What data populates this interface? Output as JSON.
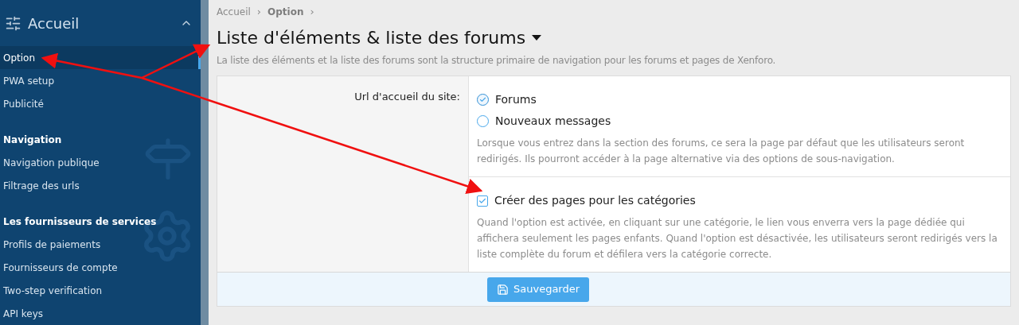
{
  "sidebar": {
    "header": {
      "title": "Accueil",
      "expanded": true
    },
    "sections": [
      {
        "items": [
          {
            "label": "Option",
            "selected": true
          },
          {
            "label": "PWA setup",
            "selected": false
          },
          {
            "label": "Publicité",
            "selected": false
          }
        ]
      },
      {
        "heading": "Navigation",
        "items": [
          {
            "label": "Navigation publique",
            "selected": false
          },
          {
            "label": "Filtrage des urls",
            "selected": false
          }
        ]
      },
      {
        "heading": "Les fournisseurs de services",
        "items": [
          {
            "label": "Profils de paiements",
            "selected": false
          },
          {
            "label": "Fournisseurs de compte",
            "selected": false
          },
          {
            "label": "Two-step verification",
            "selected": false
          },
          {
            "label": "API keys",
            "selected": false
          }
        ]
      }
    ]
  },
  "breadcrumb": [
    {
      "label": "Accueil",
      "current": false,
      "separator": "›"
    },
    {
      "label": "Option",
      "current": true,
      "separator": "›"
    }
  ],
  "page": {
    "title": "Liste d'éléments & liste des forums",
    "description": "La liste des éléments et la liste des forums sont la structure primaire de navigation pour les forums et pages de Xenforo."
  },
  "form": {
    "label": "Url d'accueil du site:",
    "groups": [
      {
        "kind": "radio",
        "options": [
          {
            "label": "Forums",
            "selected": true
          },
          {
            "label": "Nouveaux messages",
            "selected": false
          }
        ],
        "hint": "Lorsque vous entrez dans la section des forums, ce sera la page par défaut que les utilisateurs seront redirigés. Ils pourront accéder à la page alternative via des options de sous-navigation."
      },
      {
        "kind": "checkbox",
        "options": [
          {
            "label": "Créer des pages pour les catégories",
            "checked": true
          }
        ],
        "hint": "Quand l'option est activée, en cliquant sur une catégorie, le lien vous enverra vers la page dédiée qui affichera seulement les pages enfants. Quand l'option est désactivée, les utilisateurs seront redirigés vers la liste complète du forum et défilera vers la catégorie correcte."
      }
    ],
    "submit": "Sauvegarder"
  }
}
